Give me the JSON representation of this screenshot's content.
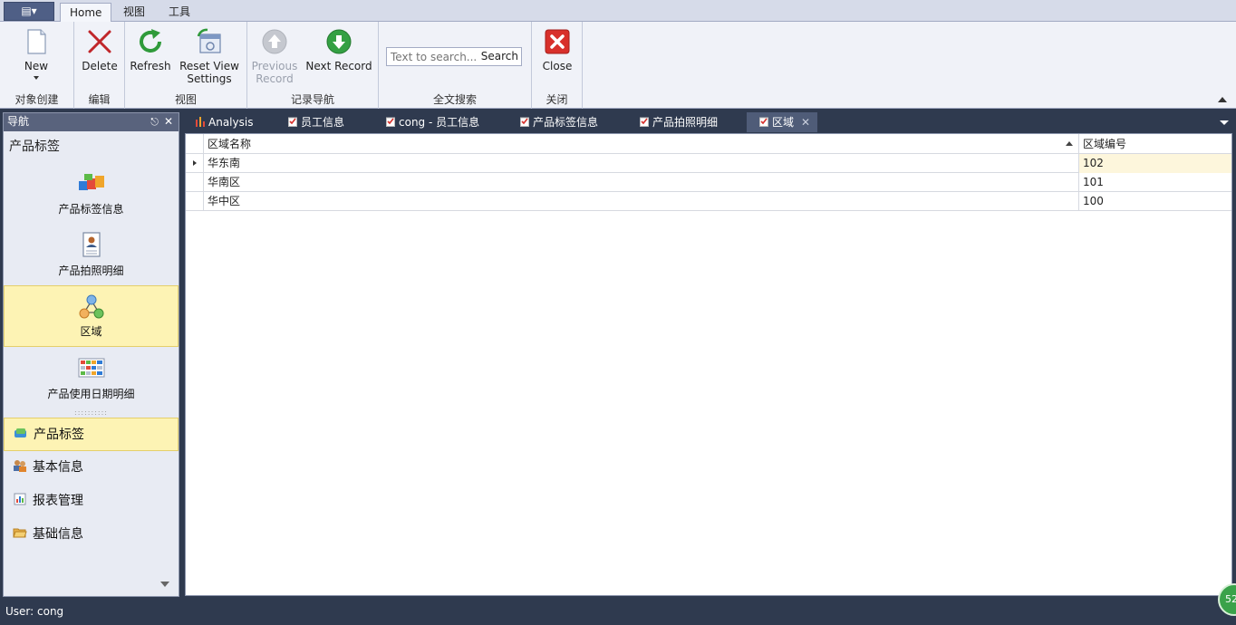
{
  "app_menu": {
    "label": "▤▾"
  },
  "ribbon_tabs": [
    {
      "label": "Home",
      "active": true
    },
    {
      "label": "视图",
      "active": false
    },
    {
      "label": "工具",
      "active": false
    }
  ],
  "ribbon": {
    "groups": [
      {
        "label": "对象创建"
      },
      {
        "label": "编辑"
      },
      {
        "label": "视图"
      },
      {
        "label": "记录导航"
      },
      {
        "label": "全文搜索"
      },
      {
        "label": "关闭"
      }
    ],
    "buttons": {
      "new": "New",
      "delete": "Delete",
      "refresh": "Refresh",
      "reset_view_1": "Reset View",
      "reset_view_2": "Settings",
      "previous_1": "Previous",
      "previous_2": "Record",
      "next_record": "Next Record",
      "close": "Close"
    },
    "search": {
      "placeholder": "Text to search...",
      "button": "Search"
    }
  },
  "nav": {
    "title": "导航",
    "group_title": "产品标签",
    "items": [
      {
        "label": "产品标签信息",
        "icon": "cubes-icon",
        "selected": false
      },
      {
        "label": "产品拍照明细",
        "icon": "id-card-icon",
        "selected": false
      },
      {
        "label": "区域",
        "icon": "relations-icon",
        "selected": true
      },
      {
        "label": "产品使用日期明细",
        "icon": "table-icon",
        "selected": false
      }
    ],
    "groups": [
      {
        "label": "产品标签",
        "icon": "tag-icon",
        "selected": true
      },
      {
        "label": "基本信息",
        "icon": "people-icon",
        "selected": false
      },
      {
        "label": "报表管理",
        "icon": "report-icon",
        "selected": false
      },
      {
        "label": "基础信息",
        "icon": "folder-icon",
        "selected": false
      }
    ]
  },
  "doc_tabs": [
    {
      "label": "Analysis",
      "icon": "chart-icon"
    },
    {
      "label": "员工信息",
      "icon": "checklist-icon"
    },
    {
      "label": "cong - 员工信息",
      "icon": "checklist-icon"
    },
    {
      "label": "产品标签信息",
      "icon": "checklist-icon"
    },
    {
      "label": "产品拍照明细",
      "icon": "checklist-icon"
    },
    {
      "label": "区域",
      "icon": "checklist-icon",
      "active": true
    }
  ],
  "grid": {
    "columns": [
      "区域名称",
      "区域编号"
    ],
    "rows": [
      [
        "华东南",
        "102"
      ],
      [
        "华南区",
        "101"
      ],
      [
        "华中区",
        "100"
      ]
    ]
  },
  "status": {
    "user": "User: cong",
    "badge": "52"
  },
  "colors": {
    "accent": "#2f3a4f",
    "selection": "#fdf3b4"
  }
}
